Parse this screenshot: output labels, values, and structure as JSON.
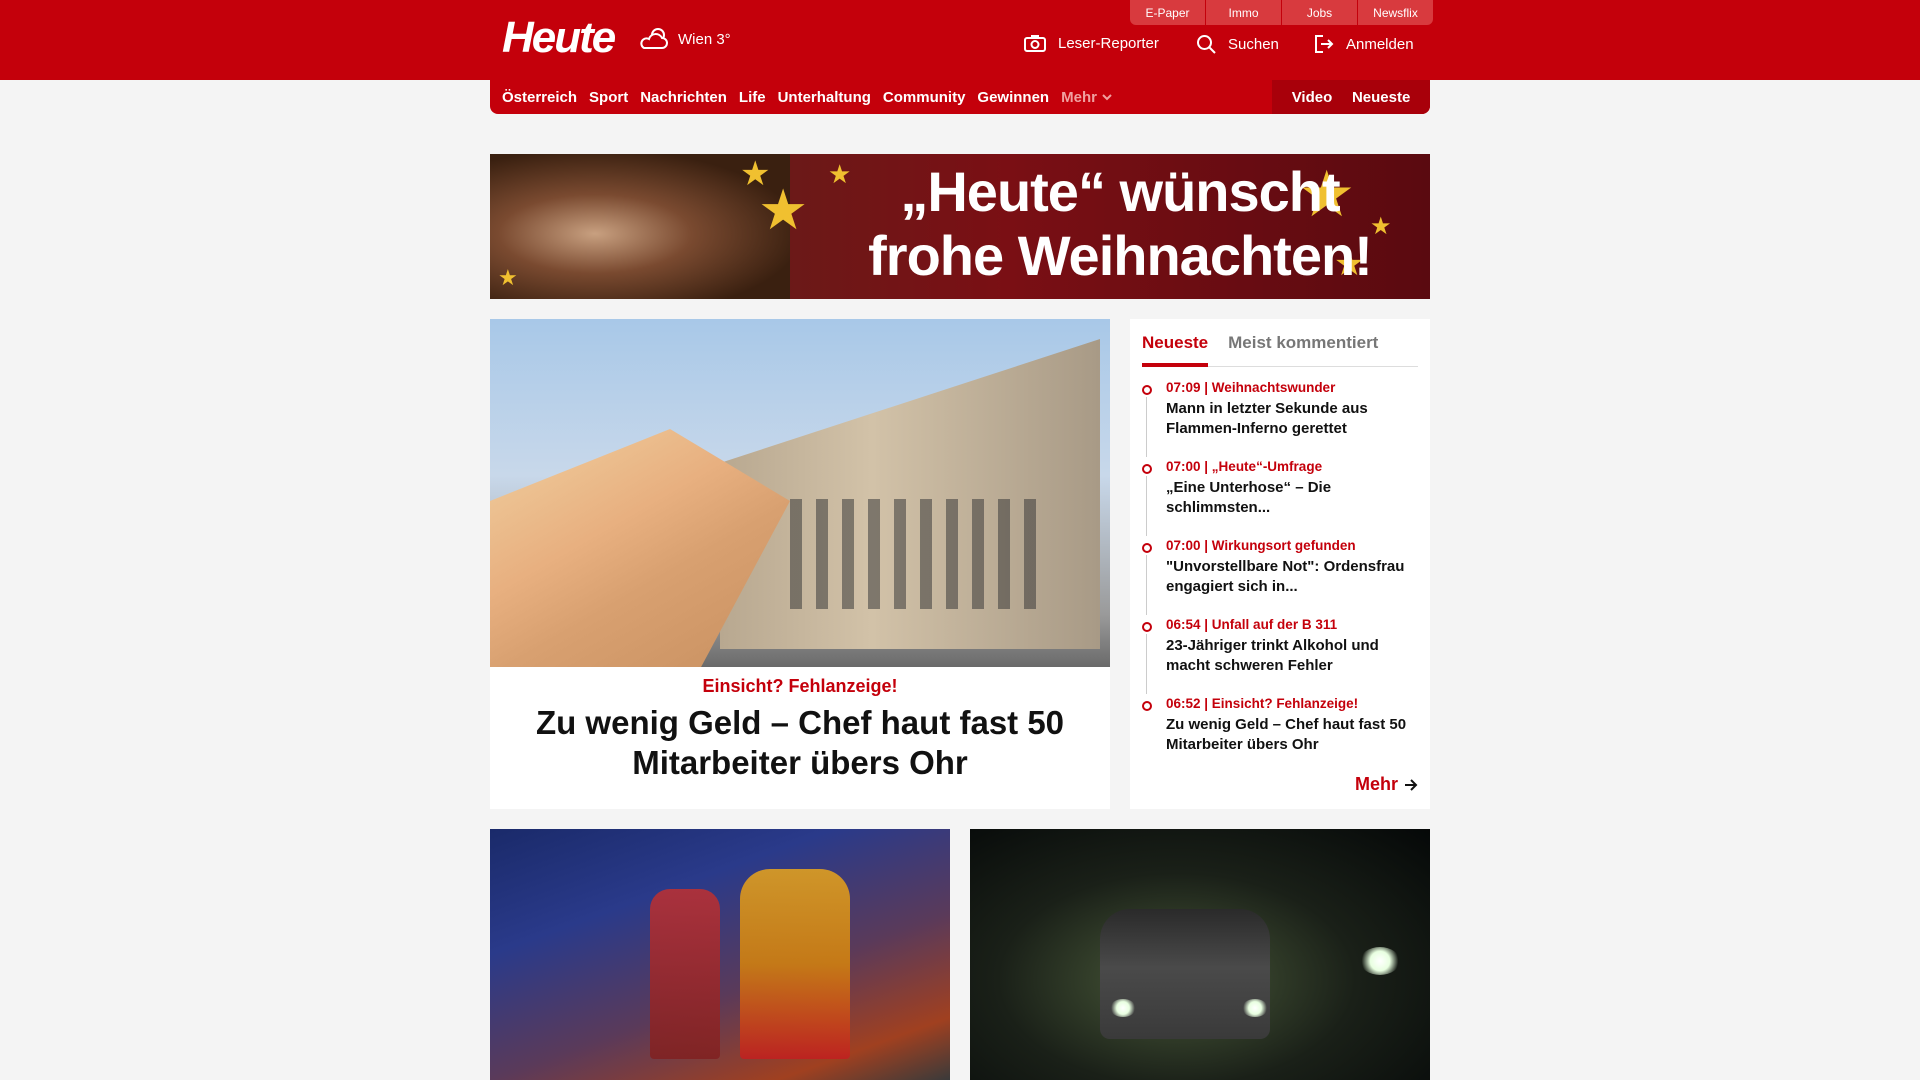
{
  "header": {
    "logo": "Heute",
    "weather": "Wien 3°",
    "top_links": [
      "E-Paper",
      "Immo",
      "Jobs",
      "Newsflix"
    ],
    "leser_reporter": "Leser-Reporter",
    "search": "Suchen",
    "login": "Anmelden"
  },
  "nav": {
    "items": [
      "Österreich",
      "Sport",
      "Nachrichten",
      "Life",
      "Unterhaltung",
      "Community",
      "Gewinnen"
    ],
    "more": "Mehr",
    "video": "Video",
    "latest": "Neueste"
  },
  "banner": {
    "line1": "„Heute“ wünscht",
    "line2": "frohe Weihnachten!"
  },
  "hero": {
    "kicker": "Einsicht? Fehlanzeige!",
    "title": "Zu wenig Geld – Chef haut fast 50 Mitarbeiter übers Ohr"
  },
  "sidebar": {
    "tab_latest": "Neueste",
    "tab_comments": "Meist kommentiert",
    "items": [
      {
        "meta": "07:09 | Weihnachtswunder",
        "title": "Mann in letzter Sekunde aus Flammen-Inferno gerettet"
      },
      {
        "meta": "07:00 | „Heute“-Umfrage",
        "title": "„Eine Unterhose“ – Die schlimmsten..."
      },
      {
        "meta": "07:00 | Wirkungsort gefunden",
        "title": "\"Unvorstellbare Not\": Ordensfrau engagiert sich in..."
      },
      {
        "meta": "06:54 | Unfall auf der B 311",
        "title": "23-Jähriger trinkt Alkohol und macht schweren Fehler"
      },
      {
        "meta": "06:52 | Einsicht? Fehlanzeige!",
        "title": "Zu wenig Geld – Chef haut fast 50 Mitarbeiter übers Ohr"
      }
    ],
    "more": "Mehr"
  },
  "colors": {
    "brand": "#c4000b",
    "background": "#f4f4f4"
  }
}
